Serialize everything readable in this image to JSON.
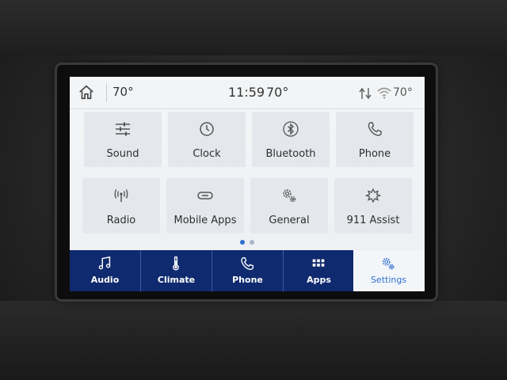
{
  "status_bar": {
    "left_temp": "70°",
    "time": "11:59",
    "center_temp": "70°",
    "right_temp": "70°"
  },
  "settings_tiles": [
    {
      "label": "Sound",
      "icon": "sliders-icon"
    },
    {
      "label": "Clock",
      "icon": "clock-icon"
    },
    {
      "label": "Bluetooth",
      "icon": "bluetooth-icon"
    },
    {
      "label": "Phone",
      "icon": "phone-icon"
    },
    {
      "label": "Radio",
      "icon": "radio-antenna-icon"
    },
    {
      "label": "Mobile Apps",
      "icon": "link-icon"
    },
    {
      "label": "General",
      "icon": "gears-icon"
    },
    {
      "label": "911 Assist",
      "icon": "assist-icon"
    }
  ],
  "pager": {
    "pages": 2,
    "active": 1
  },
  "nav": [
    {
      "label": "Audio",
      "icon": "music-note-icon"
    },
    {
      "label": "Climate",
      "icon": "thermometer-icon"
    },
    {
      "label": "Phone",
      "icon": "phone-icon"
    },
    {
      "label": "Apps",
      "icon": "apps-grid-icon"
    },
    {
      "label": "Settings",
      "icon": "gears-icon",
      "active": true
    }
  ],
  "colors": {
    "nav_bg": "#0f2a6e",
    "accent": "#2f6fd0",
    "tile_bg": "#e4e8ec",
    "screen_bg": "#f2f4f6"
  }
}
